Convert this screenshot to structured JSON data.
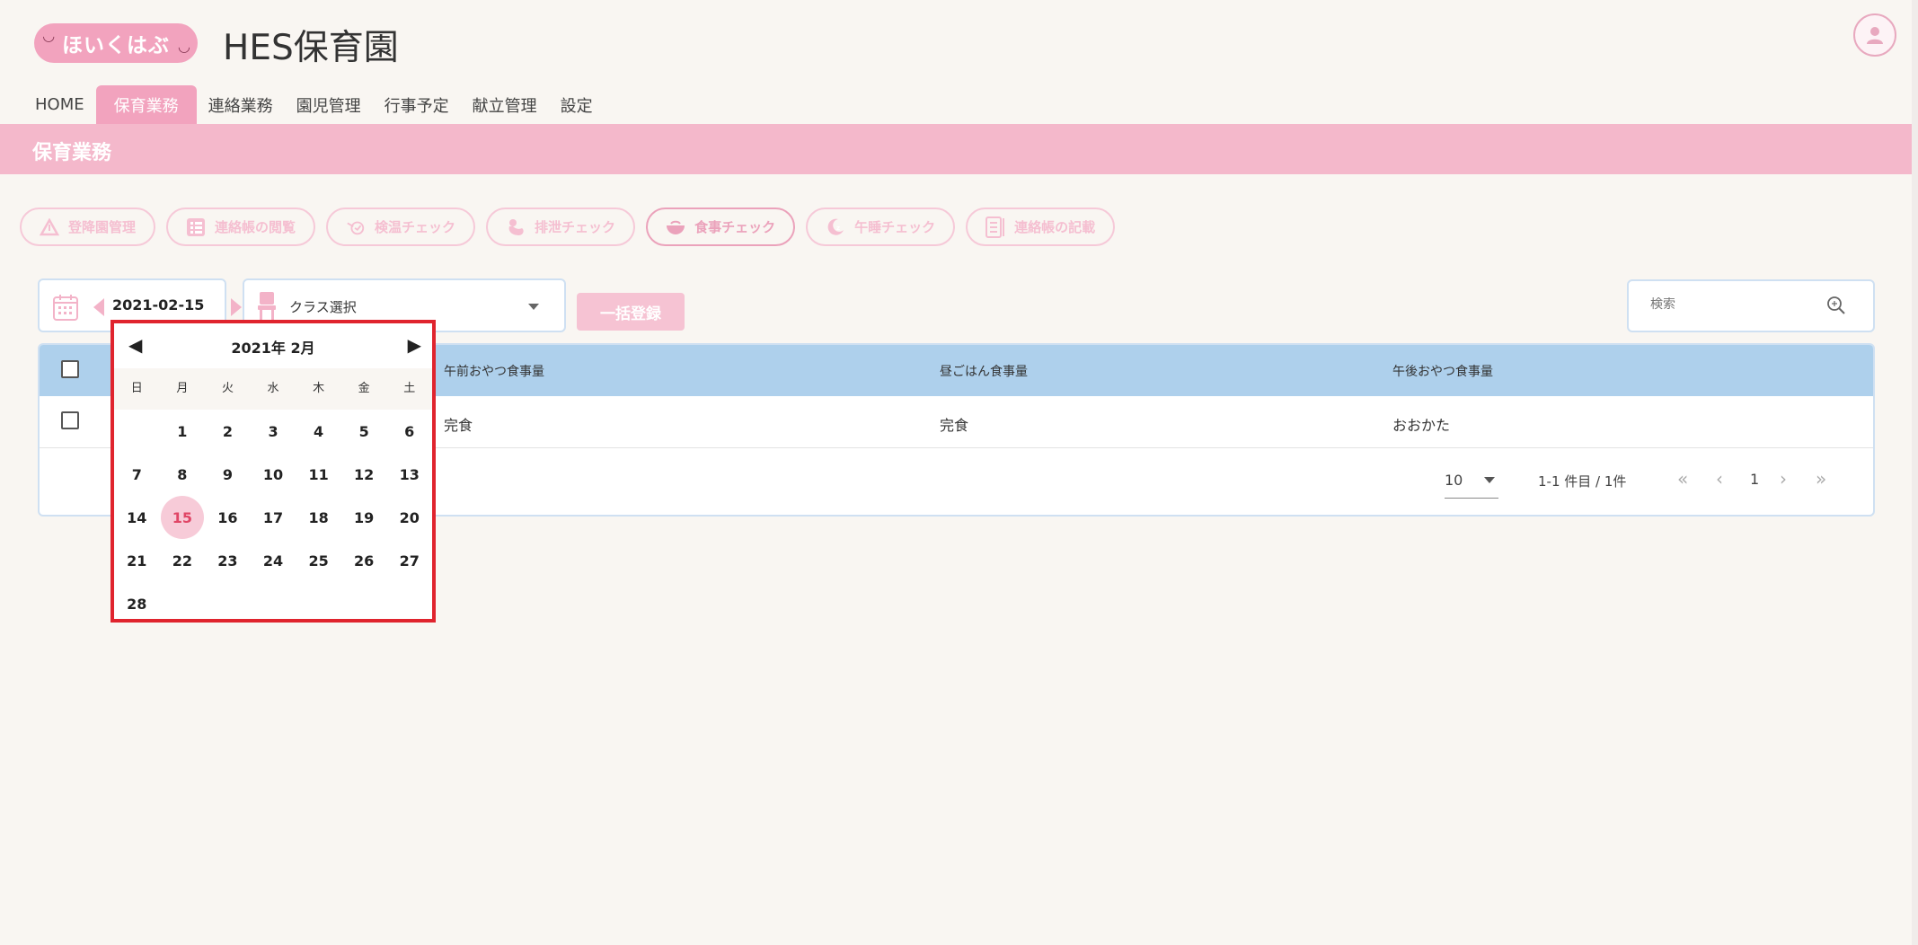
{
  "app": {
    "logo_text": "ほいくはぶ",
    "site_title": "HES保育園"
  },
  "nav": {
    "items": [
      {
        "label": "HOME",
        "active": false
      },
      {
        "label": "保育業務",
        "active": true
      },
      {
        "label": "連絡業務",
        "active": false
      },
      {
        "label": "園児管理",
        "active": false
      },
      {
        "label": "行事予定",
        "active": false
      },
      {
        "label": "献立管理",
        "active": false
      },
      {
        "label": "設定",
        "active": false
      }
    ]
  },
  "banner": {
    "title": "保育業務"
  },
  "subnav": {
    "items": [
      {
        "label": "登降園管理",
        "icon": "triangle-icon"
      },
      {
        "label": "連絡帳の閲覧",
        "icon": "list-icon"
      },
      {
        "label": "検温チェック",
        "icon": "thermometer-icon"
      },
      {
        "label": "排泄チェック",
        "icon": "duck-icon"
      },
      {
        "label": "食事チェック",
        "icon": "bowl-icon"
      },
      {
        "label": "午睡チェック",
        "icon": "sleep-icon"
      },
      {
        "label": "連絡帳の記載",
        "icon": "notebook-icon"
      }
    ]
  },
  "toolbar": {
    "date": "2021-02-15",
    "class_select": "クラス選択",
    "bulk_button": "一括登録",
    "search_placeholder": "検索"
  },
  "table": {
    "headers": [
      "午前おやつ食事量",
      "昼ごはん食事量",
      "午後おやつ食事量"
    ],
    "rows": [
      [
        "完食",
        "完食",
        "おおかた"
      ]
    ]
  },
  "pager": {
    "per_page": "10",
    "range": "1-1 件目 / 1件",
    "first": "«",
    "prev": "‹",
    "page": "1",
    "next": "›",
    "last": "»"
  },
  "calendar": {
    "month_label": "2021年 2月",
    "prev": "◀",
    "next": "▶",
    "weekdays": [
      "日",
      "月",
      "火",
      "水",
      "木",
      "金",
      "土"
    ],
    "selected_day": "15",
    "weeks": [
      [
        "",
        "1",
        "2",
        "3",
        "4",
        "5",
        "6"
      ],
      [
        "7",
        "8",
        "9",
        "10",
        "11",
        "12",
        "13"
      ],
      [
        "14",
        "15",
        "16",
        "17",
        "18",
        "19",
        "20"
      ],
      [
        "21",
        "22",
        "23",
        "24",
        "25",
        "26",
        "27"
      ],
      [
        "28",
        "",
        "",
        "",
        "",
        "",
        ""
      ]
    ]
  },
  "colors": {
    "brand_pink": "#f2a3be",
    "banner_pink": "#f4b8cb",
    "table_header_blue": "#aed0ec",
    "highlight_red": "#e0242e"
  }
}
